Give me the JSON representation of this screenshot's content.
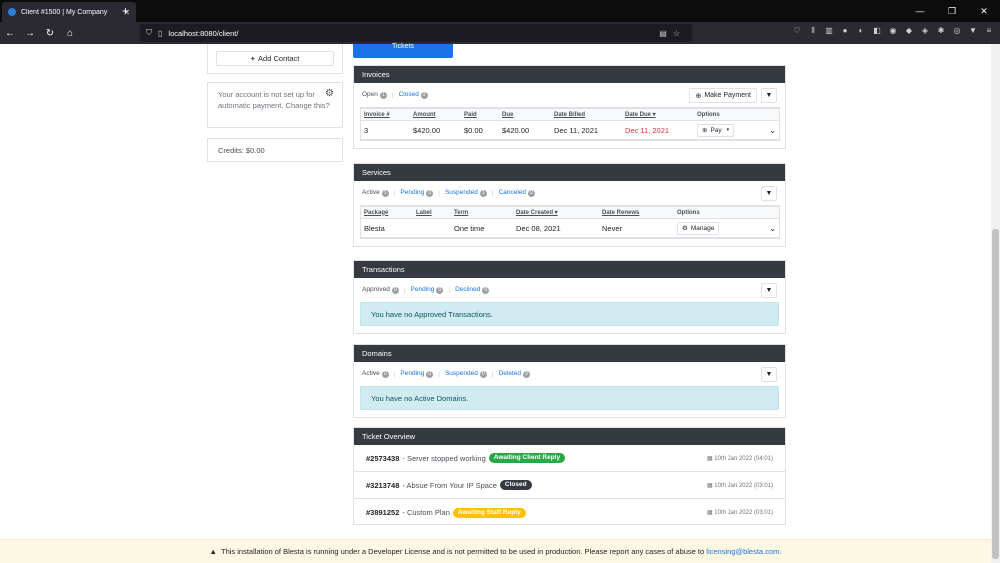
{
  "browser": {
    "tab_title": "Client #1500 | My Company",
    "url": "localhost:8080/client/"
  },
  "sidebar": {
    "add_contact_label": "Add Contact",
    "autopay_text": "Your account is not set up for automatic payment. Change this?",
    "credits_text": "Credits: $0.00"
  },
  "tickets_button": "Tickets",
  "invoices": {
    "title": "Invoices",
    "filters": [
      {
        "label": "Open",
        "count": "1"
      },
      {
        "label": "Closed",
        "count": "2"
      }
    ],
    "make_payment_label": "Make Payment",
    "columns": [
      "Invoice #",
      "Amount",
      "Paid",
      "Due",
      "Date Billed",
      "Date Due",
      "Options"
    ],
    "rows": [
      {
        "invoice": "3",
        "amount": "$420.00",
        "paid": "$0.00",
        "due": "$420.00",
        "date_billed": "Dec 11, 2021",
        "date_due": "Dec 11, 2021",
        "option": "Pay"
      }
    ]
  },
  "services": {
    "title": "Services",
    "filters": [
      {
        "label": "Active",
        "count": "1"
      },
      {
        "label": "Pending",
        "count": "0"
      },
      {
        "label": "Suspended",
        "count": "1"
      },
      {
        "label": "Canceled",
        "count": "0"
      }
    ],
    "columns": [
      "Package",
      "Label",
      "Term",
      "Date Created",
      "Date Renews",
      "Options"
    ],
    "rows": [
      {
        "package": "Blesta",
        "label": "",
        "term": "One time",
        "date_created": "Dec 08, 2021",
        "date_renews": "Never",
        "option": "Manage"
      }
    ]
  },
  "transactions": {
    "title": "Transactions",
    "filters": [
      {
        "label": "Approved",
        "count": "0"
      },
      {
        "label": "Pending",
        "count": "0"
      },
      {
        "label": "Declined",
        "count": "0"
      }
    ],
    "empty_message": "You have no Approved Transactions."
  },
  "domains": {
    "title": "Domains",
    "filters": [
      {
        "label": "Active",
        "count": "0"
      },
      {
        "label": "Pending",
        "count": "0"
      },
      {
        "label": "Suspended",
        "count": "0"
      },
      {
        "label": "Deleted",
        "count": "0"
      }
    ],
    "empty_message": "You have no Active Domains."
  },
  "ticket_overview": {
    "title": "Ticket Overview",
    "tickets": [
      {
        "number": "#2573438",
        "subject": "- Server stopped working",
        "status": "Awaiting Client Reply",
        "status_color": "#28a745",
        "date": "10th Jan 2022 (04:01)"
      },
      {
        "number": "#3213748",
        "subject": "- Absue From Your IP Space",
        "status": "Closed",
        "status_color": "#343a40",
        "date": "10th Jan 2022 (03:01)"
      },
      {
        "number": "#3891252",
        "subject": "- Custom Plan",
        "status": "Awaiting Staff Reply",
        "status_color": "#ffc107",
        "date": "10th Jan 2022 (03:01)"
      }
    ]
  },
  "footer": {
    "text": "This installation of Blesta is running under a Developer License and is not permitted to be used in production. Please report any cases of abuse to",
    "link": "licensing@blesta.com."
  }
}
